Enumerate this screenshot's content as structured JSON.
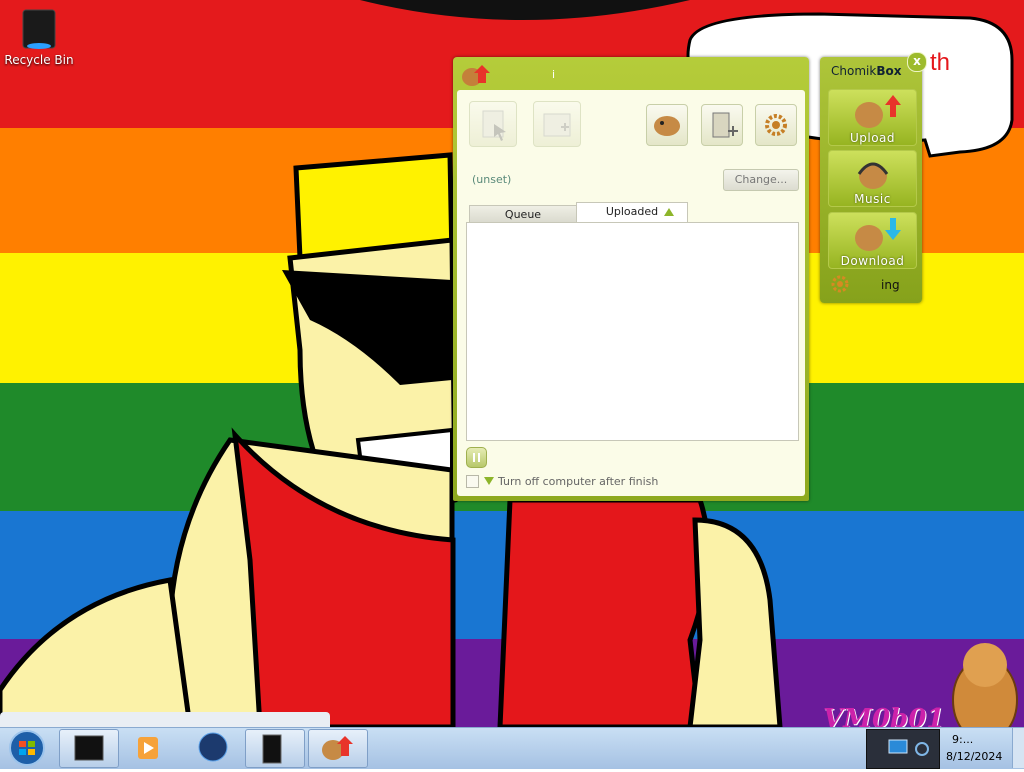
{
  "desktop": {
    "recycle_bin_label": "Recycle Bin",
    "speech_bubble_text": "",
    "watermark": "VM0b01"
  },
  "chomikbox_window": {
    "title": "i",
    "path_value": "(unset)",
    "change_button_label": "Change...",
    "tabs": [
      {
        "label": "Queue",
        "selected": false
      },
      {
        "label": "Uploaded",
        "selected": true
      }
    ],
    "shutdown_label": "Turn off computer after finish",
    "shutdown_checked": false
  },
  "side_panel": {
    "title_plain": "Chomik",
    "title_bold": "Box",
    "buttons": [
      {
        "label": "Upload"
      },
      {
        "label": "Music"
      },
      {
        "label": "Download"
      }
    ],
    "status_text": "ing",
    "close_symbol": "x"
  },
  "taskbar": {
    "clock_time": "9:...",
    "clock_date": "8/12/2024"
  },
  "colors": {
    "window_green": "#a3bd2e",
    "client_bg": "#fbfce8",
    "taskbar": "#b7d0ec"
  }
}
